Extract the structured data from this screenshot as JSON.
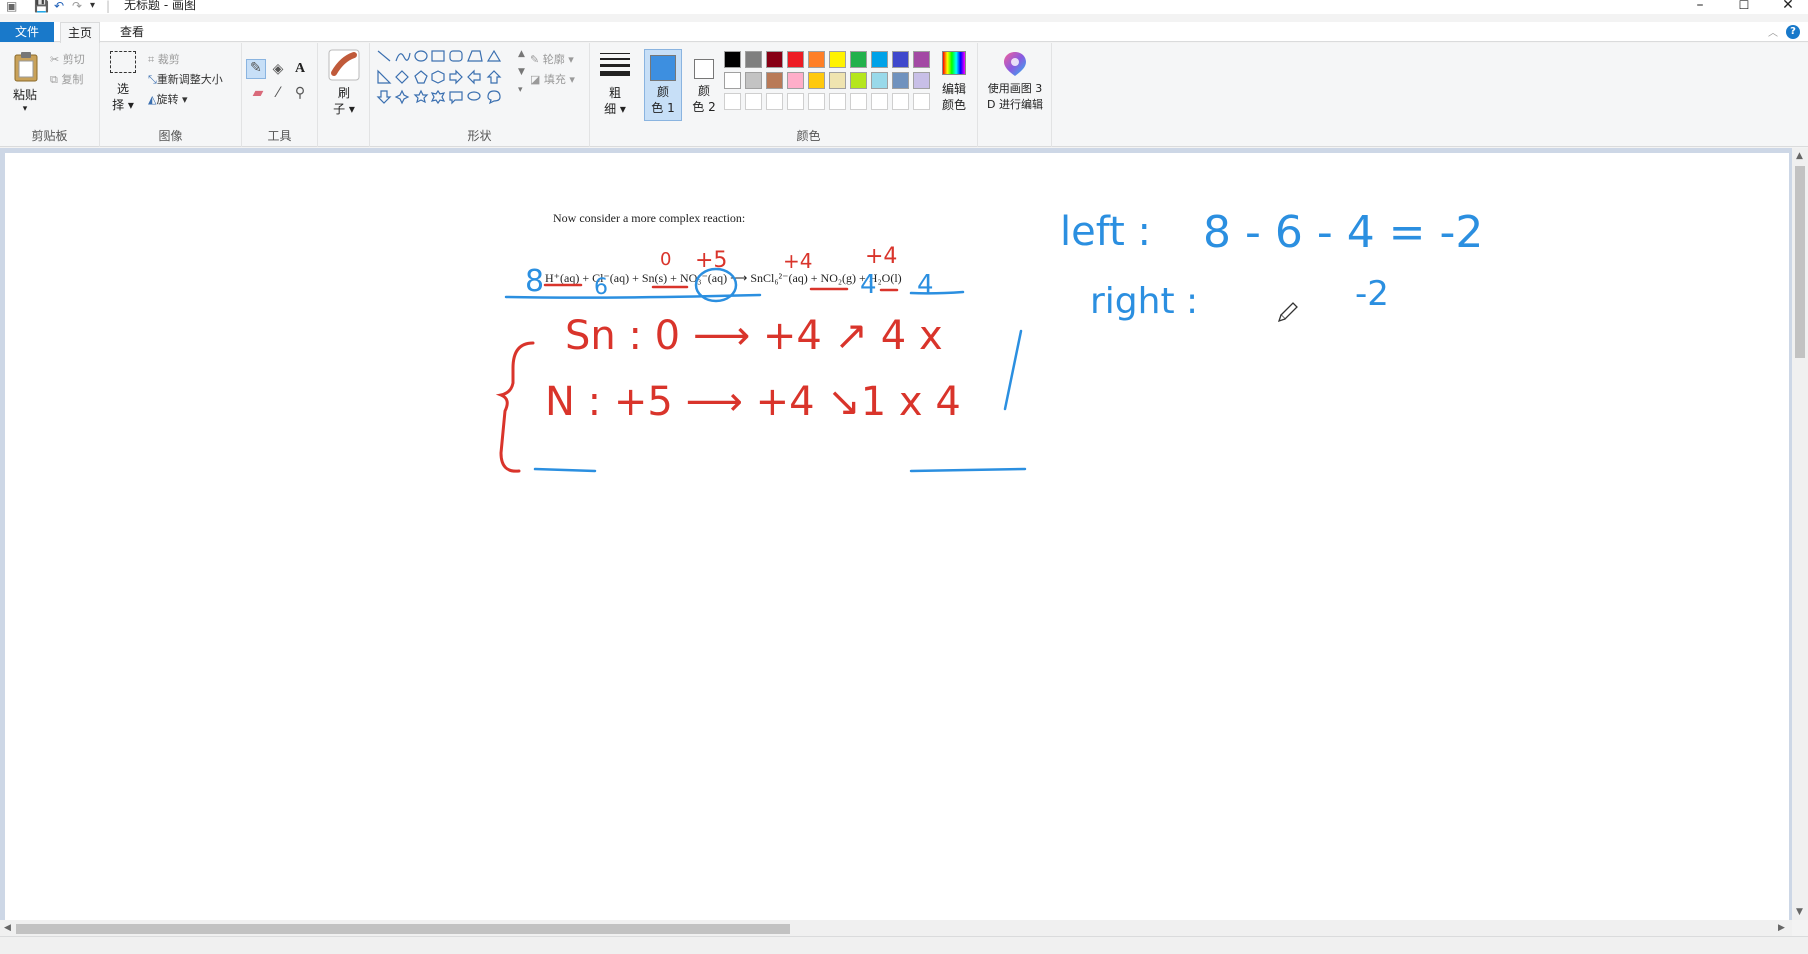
{
  "window": {
    "title": "无标题 - 画图",
    "minimize": "–",
    "maximize": "☐",
    "close": "✕"
  },
  "quick_access": {
    "save": "💾",
    "undo": "↶",
    "redo": "↷",
    "dropdown": "▾"
  },
  "tabs": {
    "file": "文件",
    "home": "主页",
    "view": "查看"
  },
  "ribbon": {
    "clipboard": {
      "paste": "粘贴",
      "paste_arrow": "▾",
      "cut": "剪切",
      "copy": "复制",
      "label": "剪贴板"
    },
    "image": {
      "select_top": "选",
      "select_bottom": "择 ▾",
      "crop": "裁剪",
      "resize": "重新调整大小",
      "rotate": "旋转 ▾",
      "label": "图像"
    },
    "tools": {
      "label": "工具"
    },
    "brushes": {
      "top": "刷",
      "bottom": "子 ▾"
    },
    "shapes": {
      "outline": "轮廓 ▾",
      "fill": "填充 ▾",
      "label": "形状"
    },
    "size": {
      "top": "粗",
      "bottom": "细 ▾"
    },
    "color1": {
      "top": "颜",
      "bottom": "色 1"
    },
    "color2": {
      "top": "颜",
      "bottom": "色 2"
    },
    "colors": {
      "label": "颜色",
      "edit_top": "编辑",
      "edit_bottom": "颜色",
      "palette_row1": [
        "#000000",
        "#7f7f7f",
        "#880015",
        "#ed1c24",
        "#ff7f27",
        "#fff200",
        "#22b14c",
        "#00a2e8",
        "#3f48cc",
        "#a349a4"
      ],
      "palette_row2": [
        "#ffffff",
        "#c3c3c3",
        "#b97a57",
        "#ffaec9",
        "#ffc90e",
        "#efe4b0",
        "#b5e61d",
        "#99d9ea",
        "#7092be",
        "#c8bfe7"
      ],
      "palette_row3": [
        "#ffffff",
        "#ffffff",
        "#ffffff",
        "#ffffff",
        "#ffffff",
        "#ffffff",
        "#ffffff",
        "#ffffff",
        "#ffffff",
        "#ffffff"
      ],
      "color1_value": "#3d8fe0",
      "color2_value": "#ffffff"
    },
    "paint3d": {
      "top": "使用画图 3",
      "bottom": "D 进行编辑"
    }
  },
  "canvas": {
    "doc_text": "Now consider a more complex reaction:",
    "equation": "H⁺(aq) + Cl⁻(aq) + Sn(s) + NO₃⁻(aq) ⟶ SnCl₆²⁻(aq) + NO₂(g) + H₂O(l)",
    "ink": {
      "coef_h": "8",
      "coef_cl": "6",
      "ox_sn": "0",
      "ox_n_left": "+5",
      "ox_sn_right": "+4",
      "ox_n_right": "+4",
      "coef_no2": "4",
      "coef_h2o": "4",
      "row1": "Sn :  0 ⟶ +4   ↗  4 x",
      "row2": "N :  +5  ⟶ +4   ↘1   x 4",
      "left_label": "left :",
      "left_value": "8 - 6 - 4 = -2",
      "right_label": "right :",
      "right_value": "-2"
    },
    "ink_colors": {
      "red": "#d9342b",
      "blue": "#2b8fe0"
    }
  }
}
